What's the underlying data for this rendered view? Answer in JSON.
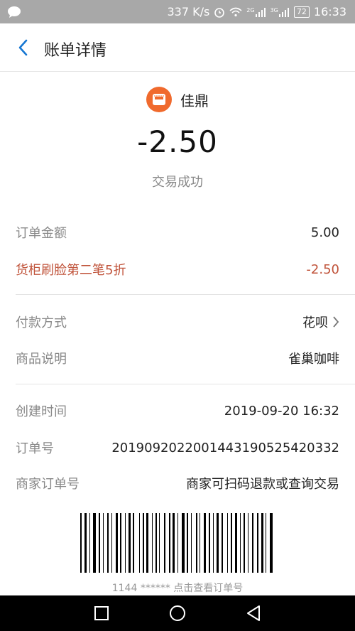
{
  "status_bar": {
    "network_speed": "337 K/s",
    "signal_2g": "2G",
    "signal_3g": "3G",
    "battery": "72",
    "time": "16:33"
  },
  "header": {
    "title": "账单详情"
  },
  "merchant": {
    "name": "佳鼎",
    "amount": "-2.50",
    "status": "交易成功"
  },
  "rows": {
    "order_amount": {
      "label": "订单金额",
      "value": "5.00"
    },
    "discount": {
      "label": "货柜刷脸第二笔5折",
      "value": "-2.50"
    },
    "payment_method": {
      "label": "付款方式",
      "value": "花呗"
    },
    "product_desc": {
      "label": "商品说明",
      "value": "雀巢咖啡"
    },
    "created_time": {
      "label": "创建时间",
      "value": "2019-09-20 16:32"
    },
    "order_no": {
      "label": "订单号",
      "value": "2019092022001443190525420332"
    },
    "merchant_order_no": {
      "label": "商家订单号",
      "value": "商家可扫码退款或查询交易"
    }
  },
  "barcode": {
    "caption": "1144 ****** 点击查看订单号"
  },
  "colors": {
    "accent": "#1677d2",
    "discount": "#c0533a",
    "merchant_icon": "#f06a2d"
  }
}
